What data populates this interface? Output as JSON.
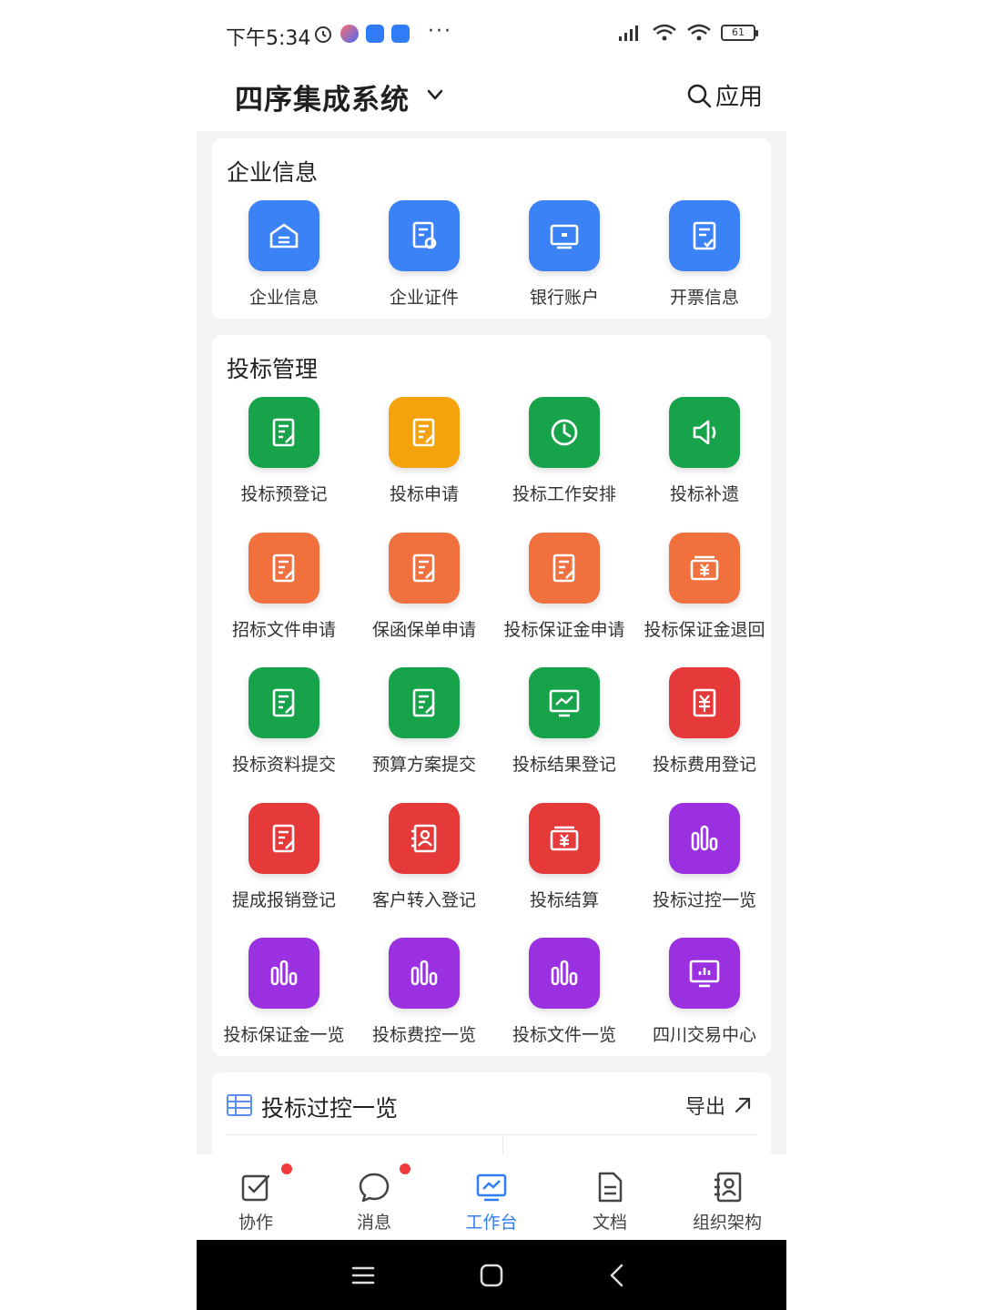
{
  "status_bar": {
    "time": "下午5:34",
    "battery": "61"
  },
  "header": {
    "title": "四序集成系统",
    "search_label": "应用"
  },
  "sections": {
    "company": {
      "title": "企业信息",
      "items": [
        {
          "label": "企业信息",
          "color": "#3b82f6",
          "icon": "house-icon"
        },
        {
          "label": "企业证件",
          "color": "#3b82f6",
          "icon": "certificate-icon"
        },
        {
          "label": "银行账户",
          "color": "#3b82f6",
          "icon": "bank-card-icon"
        },
        {
          "label": "开票信息",
          "color": "#3b82f6",
          "icon": "invoice-icon"
        }
      ]
    },
    "bidding": {
      "title": "投标管理",
      "items": [
        {
          "label": "投标预登记",
          "color": "#16a34a",
          "icon": "document-edit-icon"
        },
        {
          "label": "投标申请",
          "color": "#f5a30c",
          "icon": "document-edit-icon"
        },
        {
          "label": "投标工作安排",
          "color": "#16a34a",
          "icon": "clock-icon"
        },
        {
          "label": "投标补遗",
          "color": "#16a34a",
          "icon": "speaker-icon"
        },
        {
          "label": "招标文件申请",
          "color": "#f0713d",
          "icon": "document-edit-icon"
        },
        {
          "label": "保函保单申请",
          "color": "#f0713d",
          "icon": "document-edit-icon"
        },
        {
          "label": "投标保证金申请",
          "color": "#f0713d",
          "icon": "document-edit-icon"
        },
        {
          "label": "投标保证金退回",
          "color": "#f0713d",
          "icon": "yuan-box-icon"
        },
        {
          "label": "投标资料提交",
          "color": "#16a34a",
          "icon": "document-edit-icon"
        },
        {
          "label": "预算方案提交",
          "color": "#16a34a",
          "icon": "document-edit-icon"
        },
        {
          "label": "投标结果登记",
          "color": "#16a34a",
          "icon": "monitor-chart-icon"
        },
        {
          "label": "投标费用登记",
          "color": "#e5393a",
          "icon": "yuan-ticket-icon"
        },
        {
          "label": "提成报销登记",
          "color": "#e5393a",
          "icon": "document-edit-icon"
        },
        {
          "label": "客户转入登记",
          "color": "#e5393a",
          "icon": "contact-book-icon"
        },
        {
          "label": "投标结算",
          "color": "#e5393a",
          "icon": "yuan-box-icon"
        },
        {
          "label": "投标过控一览",
          "color": "#9b30e0",
          "icon": "bar-chart-icon"
        },
        {
          "label": "投标保证金一览",
          "color": "#9b30e0",
          "icon": "bar-chart-icon"
        },
        {
          "label": "投标费控一览",
          "color": "#9b30e0",
          "icon": "bar-chart-icon"
        },
        {
          "label": "投标文件一览",
          "color": "#9b30e0",
          "icon": "bar-chart-icon"
        },
        {
          "label": "四川交易中心",
          "color": "#9b30e0",
          "icon": "screen-chart-icon"
        }
      ]
    }
  },
  "preview": {
    "title": "投标过控一览",
    "export_label": "导出"
  },
  "tabbar": {
    "items": [
      {
        "label": "协作",
        "icon": "checkbox-icon",
        "badge": true
      },
      {
        "label": "消息",
        "icon": "chat-bubble-icon",
        "badge": true
      },
      {
        "label": "工作台",
        "icon": "workbench-icon",
        "active": true
      },
      {
        "label": "文档",
        "icon": "document-icon"
      },
      {
        "label": "组织架构",
        "icon": "contacts-icon"
      }
    ]
  },
  "colors": {
    "accent": "#2f7cf6",
    "badge": "#ef3b3b"
  }
}
